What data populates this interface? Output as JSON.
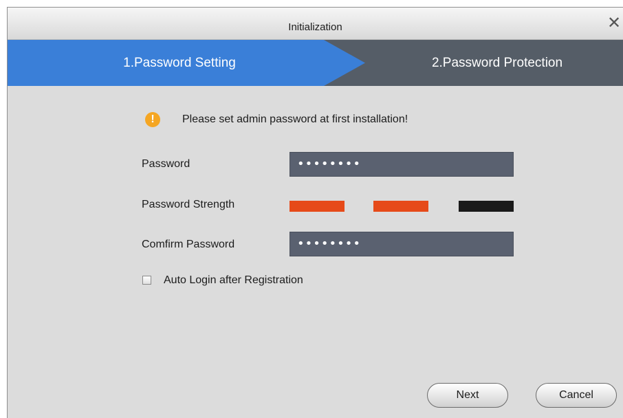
{
  "window": {
    "title": "Initialization",
    "close_symbol": "✕"
  },
  "steps": [
    {
      "label": "1.Password Setting",
      "active": true
    },
    {
      "label": "2.Password Protection",
      "active": false
    }
  ],
  "alert": {
    "icon": "warning-icon",
    "symbol": "!",
    "text": "Please set admin password at first installation!"
  },
  "form": {
    "password_label": "Password",
    "password_value": "••••••••",
    "strength_label": "Password Strength",
    "strength_level": "2 of 3",
    "confirm_label": "Comfirm Password",
    "confirm_value": "••••••••",
    "auto_login_label": "Auto Login after Registration",
    "auto_login_checked": false
  },
  "buttons": {
    "next": "Next",
    "cancel": "Cancel"
  },
  "colors": {
    "step_active": "#3a7fd8",
    "step_inactive": "#555d67",
    "field_bg": "#5a6170",
    "strength_on": "#e64a19",
    "strength_off": "#1a1a1a",
    "warning": "#f5a623"
  }
}
